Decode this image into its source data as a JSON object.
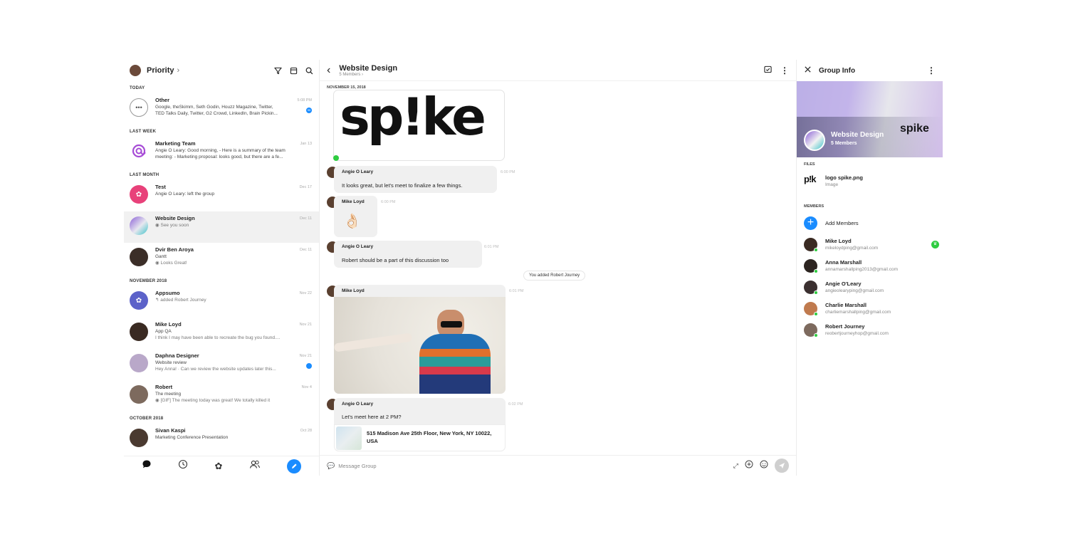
{
  "left": {
    "title": "Priority",
    "sections": [
      {
        "label": "TODAY",
        "items": [
          {
            "name": "Other",
            "line1": "Google, theSkimm, Seth Godin, Houzz Magazine, Twitter,",
            "line2": "TED Talks Daily, Twitter, G2 Crowd, LinkedIn, Brain Pickin...",
            "date": "5:08 PM",
            "badge": "99"
          }
        ]
      },
      {
        "label": "LAST WEEK",
        "items": [
          {
            "name": "Marketing Team",
            "line1": "Angie O Leary: Good morning, - Here is a summary of the team",
            "line2": "meeting: - Marketing proposal: looks good, but there are a fe...",
            "date": "Jan 13"
          }
        ]
      },
      {
        "label": "LAST MONTH",
        "items": [
          {
            "name": "Test",
            "line1": "Angie O Leary: left the group",
            "date": "Dec 17"
          },
          {
            "name": "Website Design",
            "line1": "See you soon",
            "date": "Dec 11"
          },
          {
            "name": "Dvir Ben Aroya",
            "line1": "Gantt",
            "line2": "Looks Great!",
            "date": "Dec 11"
          }
        ]
      },
      {
        "label": "NOVEMBER 2018",
        "items": [
          {
            "name": "Appsumo",
            "line1": "added Robert Journey",
            "date": "Nov 22"
          },
          {
            "name": "Mike Loyd",
            "line1": "App QA",
            "line2": "I think I may have been able to recreate the bug you found....",
            "date": "Nov 21"
          },
          {
            "name": "Daphna Designer",
            "line1": "Website review",
            "line2": "Hey Anna! · Can we review the website updates later this...",
            "date": "Nov 21"
          },
          {
            "name": "Robert",
            "line1": "The meeting",
            "line2": "[GIF] The meeting today was great! We totally killed it",
            "date": "Nov 4"
          }
        ]
      },
      {
        "label": "OCTOBER 2018",
        "items": [
          {
            "name": "Sivan Kaspi",
            "line1": "Marketing Conference Presentation",
            "date": "Oct 28"
          }
        ]
      }
    ]
  },
  "chat": {
    "title": "Website Design",
    "subtitle": "5 Members",
    "date_label": "NOVEMBER 15, 2018",
    "logo_text": "sp!ke",
    "messages": [
      {
        "sender": "Angie O Leary",
        "text": "It looks great, but let's meet to finalize a few things.",
        "time": "6:00 PM"
      },
      {
        "sender": "Mike Loyd",
        "text": "👌🏻",
        "time": "6:00 PM"
      },
      {
        "sender": "Angie O Leary",
        "text": "Robert should be a part of this discussion too",
        "time": "6:01 PM"
      },
      {
        "sender": "Mike Loyd",
        "time": "6:01 PM"
      },
      {
        "sender": "Angie O Leary",
        "text": "Let's meet here at 2 PM?",
        "time": "6:02 PM",
        "location": "515 Madison Ave 25th Floor, New York, NY 10022, USA"
      }
    ],
    "system_message": "You added Robert Journey",
    "input_placeholder": "Message Group"
  },
  "info": {
    "title": "Group Info",
    "banner_title": "Website Design",
    "banner_sub": "5 Members",
    "banner_logo": "spike",
    "files_label": "FILES",
    "file": {
      "name": "logo spike.png",
      "type": "Image"
    },
    "members_label": "MEMBERS",
    "add_members": "Add Members",
    "members": [
      {
        "name": "Mike Loyd",
        "email": "mikeloydping@gmail.com"
      },
      {
        "name": "Anna Marshall",
        "email": "annamarshallping2013@gmail.com"
      },
      {
        "name": "Angie O'Leary",
        "email": "angieolearyping@gmail.com"
      },
      {
        "name": "Charlie Marshall",
        "email": "charliemarshallping@gmail.com"
      },
      {
        "name": "Robert Journey",
        "email": "reobertjourneyhop@gmail.com"
      }
    ]
  }
}
